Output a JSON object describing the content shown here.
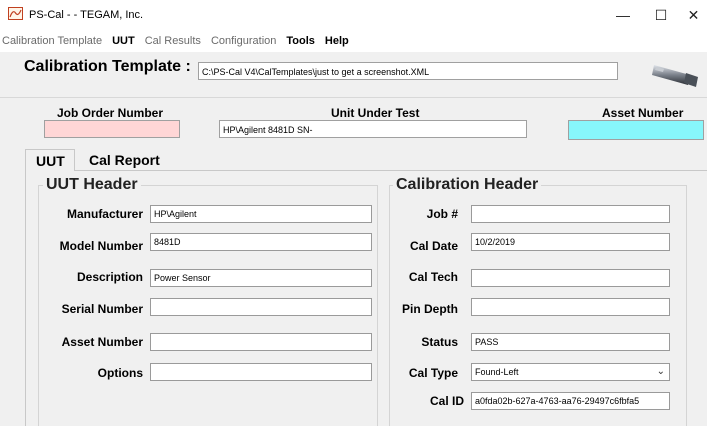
{
  "window": {
    "title": "PS-Cal - - TEGAM, Inc.",
    "minimize_glyph": "—",
    "maximize_glyph": "☐",
    "close_glyph": "✕"
  },
  "menu": [
    {
      "label": "Calibration Template",
      "bold": false
    },
    {
      "label": "UUT",
      "bold": true
    },
    {
      "label": "Cal Results",
      "bold": false
    },
    {
      "label": "Configuration",
      "bold": false
    },
    {
      "label": "Tools",
      "bold": true
    },
    {
      "label": "Help",
      "bold": true
    }
  ],
  "template": {
    "label": "Calibration Template :",
    "path": "C:\\PS-Cal  V4\\CalTemplates\\just to get a screenshot.XML"
  },
  "header": {
    "job_order_label": "Job Order Number",
    "job_order_value": "",
    "uut_label": "Unit Under Test",
    "uut_value": "HP\\Agilent 8481D SN-",
    "asset_label": "Asset Number",
    "asset_value": "",
    "job_order_color": "#ffd6d6",
    "asset_color": "#87f7fb"
  },
  "tabs": [
    {
      "label": "UUT",
      "active": true
    },
    {
      "label": "Cal Report",
      "active": false
    }
  ],
  "uut_header": {
    "title": "UUT Header",
    "fields": [
      {
        "label": "Manufacturer",
        "value": "HP\\Agilent"
      },
      {
        "label": "Model Number",
        "value": "8481D"
      },
      {
        "label": "Description",
        "value": "Power Sensor"
      },
      {
        "label": "Serial Number",
        "value": ""
      },
      {
        "label": "Asset Number",
        "value": ""
      },
      {
        "label": "Options",
        "value": ""
      }
    ]
  },
  "cal_header": {
    "title": "Calibration Header",
    "fields": [
      {
        "label": "Job #",
        "value": ""
      },
      {
        "label": "Cal Date",
        "value": "10/2/2019"
      },
      {
        "label": "Cal Tech",
        "value": ""
      },
      {
        "label": "Pin Depth",
        "value": ""
      },
      {
        "label": "Status",
        "value": "PASS"
      },
      {
        "label": "Cal Type",
        "value": "Found-Left",
        "dropdown": true
      },
      {
        "label": "Cal ID",
        "value": "a0fda02b-627a-4763-aa76-29497c6fbfa5"
      }
    ]
  }
}
